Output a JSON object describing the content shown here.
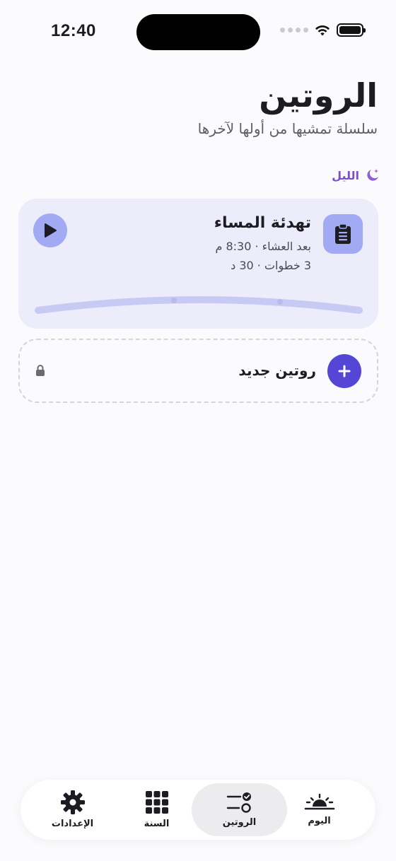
{
  "status": {
    "time": "12:40"
  },
  "header": {
    "title": "الروتين",
    "subtitle": "سلسلة تمشيها من أولها لآخرها"
  },
  "section": {
    "label": "الليل",
    "icon": "moon-stars-icon",
    "color": "#7a4fc7"
  },
  "routine": {
    "title": "تهدئة المساء",
    "line1": "بعد العشاء · 8:30 م",
    "line2": "3 خطوات · 30 د",
    "icon": "clipboard-icon",
    "accent": "#a3aaf4",
    "steps": 3,
    "progress": 0
  },
  "new_routine": {
    "label": "روتين جديد",
    "accent": "#5546d6"
  },
  "tabs": [
    {
      "id": "today",
      "label": "اليوم",
      "icon": "sunrise-icon",
      "active": false
    },
    {
      "id": "routines",
      "label": "الروتين",
      "icon": "routine-toggle-icon",
      "active": true
    },
    {
      "id": "year",
      "label": "السنة",
      "icon": "grid-icon",
      "active": false
    },
    {
      "id": "settings",
      "label": "الإعدادات",
      "icon": "gear-icon",
      "active": false
    }
  ]
}
